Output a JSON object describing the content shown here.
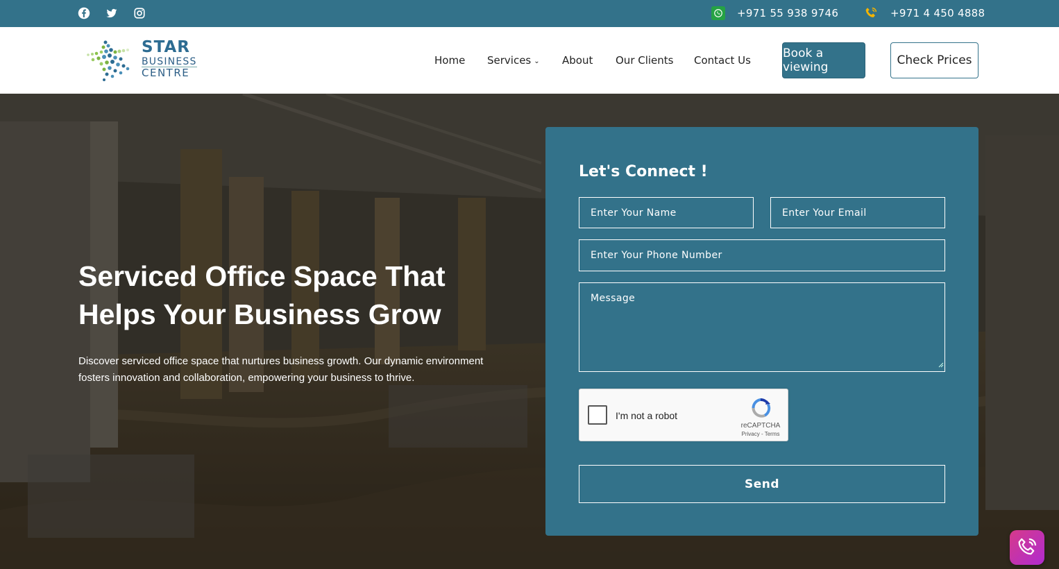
{
  "topbar": {
    "social_icons": [
      "facebook-icon",
      "twitter-icon",
      "instagram-icon"
    ],
    "whatsapp_number": "+971 55 938 9746",
    "phone_number": "+971 4 450 4888"
  },
  "header": {
    "logo": {
      "line1": "STAR",
      "line2": "BUSINESS",
      "line3": "CENTRE"
    },
    "nav": {
      "home": "Home",
      "services": "Services",
      "about": "About",
      "clients": "Our Clients",
      "contact": "Contact Us"
    },
    "book_label": "Book a viewing",
    "check_label": "Check Prices"
  },
  "hero": {
    "title_line1": "Serviced Office Space That",
    "title_line2": "Helps Your Business Grow",
    "description": "Discover serviced office space that nurtures business growth. Our dynamic environment fosters innovation and collaboration, empowering your business to thrive."
  },
  "form": {
    "title": "Let's Connect !",
    "name_placeholder": "Enter Your Name",
    "email_placeholder": "Enter Your Email",
    "phone_placeholder": "Enter Your Phone Number",
    "message_placeholder": "Message",
    "captcha_label": "I'm not a robot",
    "captcha_brand": "reCAPTCHA",
    "captcha_links": "Privacy - Terms",
    "send_label": "Send"
  },
  "colors": {
    "primary": "#33728a",
    "whatsapp": "#25a244",
    "floating_call": "#c932b0"
  }
}
